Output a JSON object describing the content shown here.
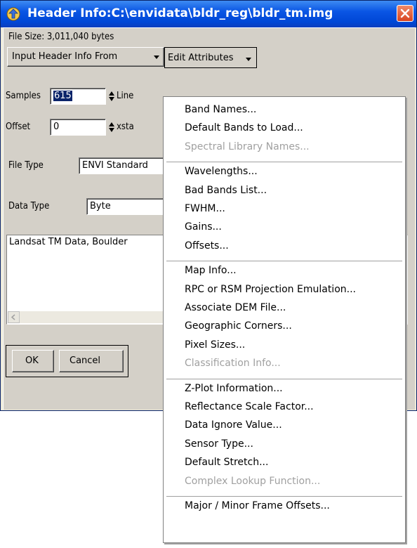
{
  "window": {
    "title": "Header Info:C:\\envidata\\bldr_reg\\bldr_tm.img"
  },
  "file_size": "File Size: 3,011,040 bytes",
  "toolbar": {
    "input_header_label": "Input Header Info From",
    "edit_attributes_label": "Edit Attributes"
  },
  "fields": {
    "samples_label": "Samples",
    "samples_value": "615",
    "lines_label": "Line",
    "offset_label": "Offset",
    "offset_value": "0",
    "xstart_label": "xsta",
    "file_type_label": "File Type",
    "file_type_value": "ENVI Standard",
    "data_type_label": "Data Type",
    "data_type_value": "Byte"
  },
  "description": "Landsat TM Data, Boulder",
  "buttons": {
    "ok": "OK",
    "cancel": "Cancel"
  },
  "menu": {
    "groups": [
      [
        {
          "label": "Band Names...",
          "enabled": true
        },
        {
          "label": "Default Bands to Load...",
          "enabled": true
        },
        {
          "label": "Spectral Library Names...",
          "enabled": false
        }
      ],
      [
        {
          "label": "Wavelengths...",
          "enabled": true
        },
        {
          "label": "Bad Bands List...",
          "enabled": true
        },
        {
          "label": "FWHM...",
          "enabled": true
        },
        {
          "label": "Gains...",
          "enabled": true
        },
        {
          "label": "Offsets...",
          "enabled": true
        }
      ],
      [
        {
          "label": "Map Info...",
          "enabled": true
        },
        {
          "label": "RPC or RSM Projection Emulation...",
          "enabled": true
        },
        {
          "label": "Associate DEM File...",
          "enabled": true
        },
        {
          "label": "Geographic Corners...",
          "enabled": true
        },
        {
          "label": "Pixel Sizes...",
          "enabled": true
        },
        {
          "label": "Classification Info...",
          "enabled": false
        }
      ],
      [
        {
          "label": "Z-Plot Information...",
          "enabled": true
        },
        {
          "label": "Reflectance Scale Factor...",
          "enabled": true
        },
        {
          "label": "Data Ignore Value...",
          "enabled": true
        },
        {
          "label": "Sensor Type...",
          "enabled": true
        },
        {
          "label": "Default Stretch...",
          "enabled": true
        },
        {
          "label": "Complex Lookup Function...",
          "enabled": false
        }
      ],
      [
        {
          "label": "Major / Minor Frame Offsets...",
          "enabled": true
        }
      ]
    ]
  }
}
